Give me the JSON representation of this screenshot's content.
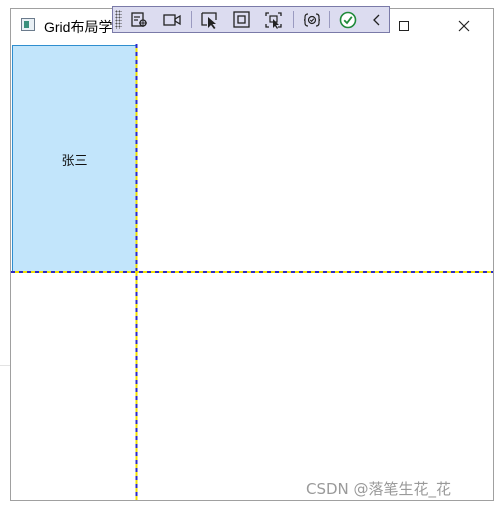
{
  "window": {
    "title": "Grid布局学"
  },
  "debug_toolbar": {
    "buttons": [
      {
        "name": "live-visual-tree-icon"
      },
      {
        "name": "record-video-icon"
      },
      {
        "name": "select-element-icon"
      },
      {
        "name": "display-layout-adorners-icon"
      },
      {
        "name": "track-focused-element-icon"
      },
      {
        "name": "binding-failures-icon"
      },
      {
        "name": "hot-reload-check-icon"
      },
      {
        "name": "collapse-chevron-icon"
      }
    ]
  },
  "grid": {
    "cell_0_0_text": "张三"
  },
  "watermark": "CSDN @落笔生花_花"
}
